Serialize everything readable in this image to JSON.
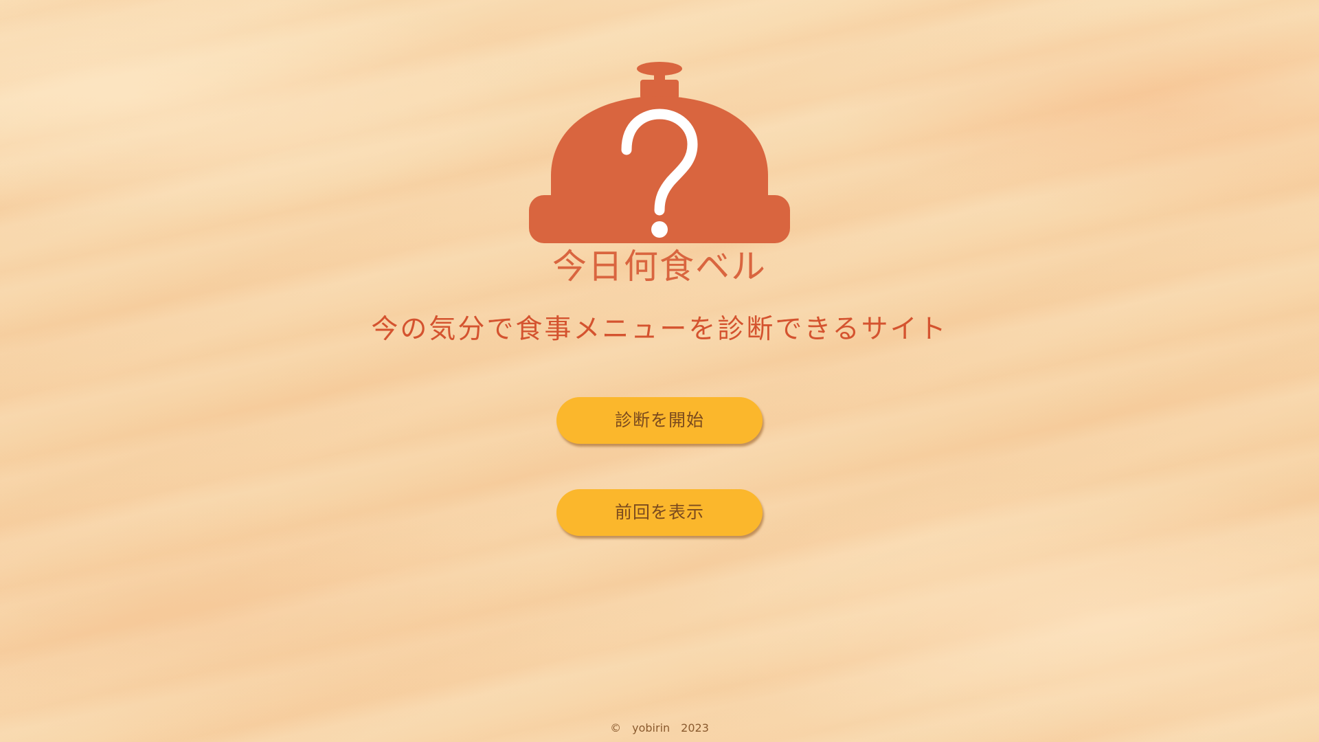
{
  "logo": {
    "icon": "service-bell-question-icon",
    "title": "今日何食ベル",
    "color": "#d9653f"
  },
  "tagline": "今の気分で食事メニューを診断できるサイト",
  "buttons": {
    "start_label": "診断を開始",
    "previous_label": "前回を表示",
    "color": "#fbb72c"
  },
  "footer": {
    "text": "©　yobirin　2023"
  }
}
